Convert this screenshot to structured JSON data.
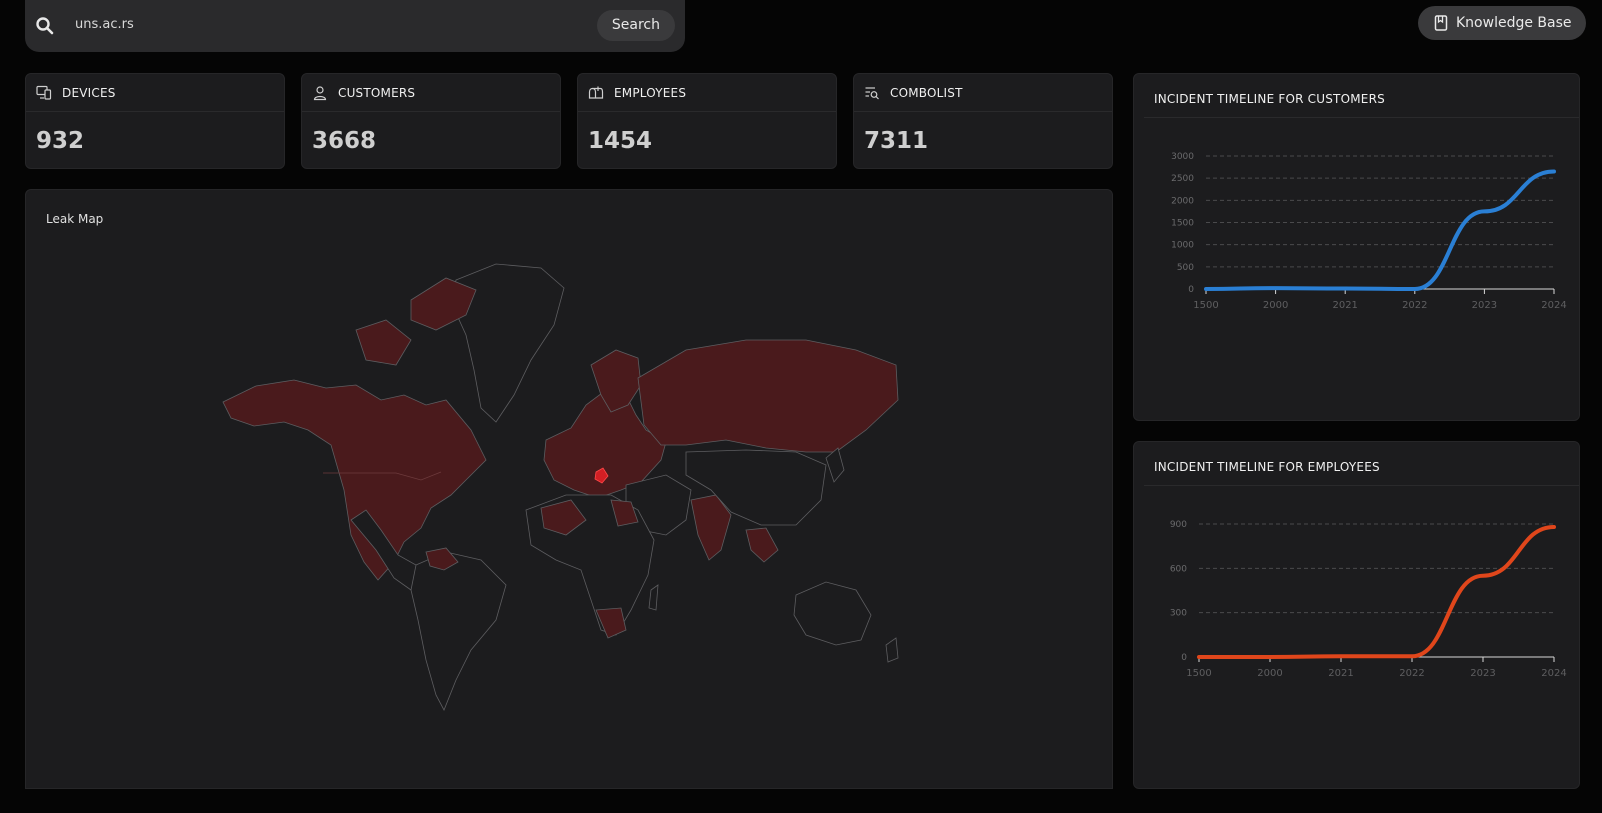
{
  "search": {
    "query": "uns.ac.rs",
    "button_label": "Search"
  },
  "header": {
    "knowledge_base_label": "Knowledge Base"
  },
  "stats": [
    {
      "label": "DEVICES",
      "value": "932",
      "icon": "monitor-icon"
    },
    {
      "label": "CUSTOMERS",
      "value": "3668",
      "icon": "user-icon"
    },
    {
      "label": "EMPLOYEES",
      "value": "1454",
      "icon": "mailbox-icon"
    },
    {
      "label": "COMBOLIST",
      "value": "7311",
      "icon": "list-search-icon"
    }
  ],
  "map": {
    "title": "Leak Map"
  },
  "colors": {
    "customers_line": "#2a7fd4",
    "employees_line": "#e0461b",
    "map_leak": "#4a1a1c",
    "map_highlight": "#d21f24"
  },
  "chart_data": [
    {
      "type": "line",
      "title": "INCIDENT TIMELINE FOR CUSTOMERS",
      "categories": [
        "1500",
        "2000",
        "2021",
        "2022",
        "2023",
        "2024"
      ],
      "yticks": [
        0,
        500,
        1000,
        1500,
        2000,
        2500,
        3000
      ],
      "ylim": [
        0,
        3000
      ],
      "grid": true,
      "series": [
        {
          "values": [
            0,
            20,
            10,
            0,
            1750,
            2650
          ]
        }
      ]
    },
    {
      "type": "line",
      "title": "INCIDENT TIMELINE FOR EMPLOYEES",
      "categories": [
        "1500",
        "2000",
        "2021",
        "2022",
        "2023",
        "2024"
      ],
      "yticks": [
        0,
        300,
        600,
        900
      ],
      "ylim": [
        0,
        900
      ],
      "grid": true,
      "series": [
        {
          "values": [
            0,
            0,
            5,
            5,
            550,
            880
          ]
        }
      ]
    }
  ]
}
